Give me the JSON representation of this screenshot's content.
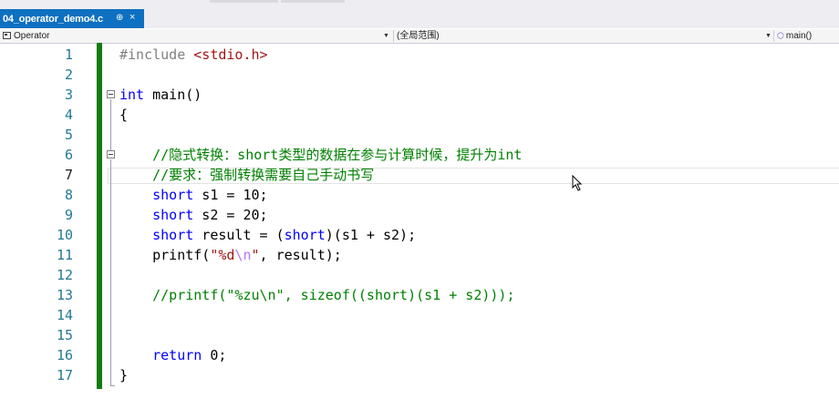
{
  "tab": {
    "title": "04_operator_demo4.c",
    "pin_glyph": "⊕",
    "close_glyph": "×"
  },
  "navbar": {
    "project": "Operator",
    "scope": "(全局范围)",
    "member": "main()"
  },
  "colors": {
    "tab_active": "#0e70c0",
    "change_bar": "#107c10",
    "keyword": "#0000ff",
    "comment": "#008000",
    "string": "#a31515",
    "line_number": "#237893"
  },
  "icons": [
    "project-icon",
    "dropdown-arrow-icon",
    "function-member-icon",
    "pin-icon",
    "close-icon",
    "collapse-icon",
    "mouse-pointer-icon"
  ],
  "editor": {
    "current_line": 7,
    "lines": [
      {
        "n": "1",
        "tokens": [
          [
            "pp",
            "#include "
          ],
          [
            "str",
            "<stdio.h>"
          ]
        ]
      },
      {
        "n": "2",
        "tokens": []
      },
      {
        "n": "3",
        "tokens": [
          [
            "kw",
            "int"
          ],
          [
            "",
            " main()"
          ]
        ]
      },
      {
        "n": "4",
        "tokens": [
          [
            "",
            "{"
          ]
        ]
      },
      {
        "n": "5",
        "tokens": []
      },
      {
        "n": "6",
        "tokens": [
          [
            "",
            "    "
          ],
          [
            "cm",
            "//隐式转换：short类型的数据在参与计算时候，提升为int"
          ]
        ]
      },
      {
        "n": "7",
        "tokens": [
          [
            "",
            "    "
          ],
          [
            "cm",
            "//要求：强制转换需要自己手动书写"
          ]
        ]
      },
      {
        "n": "8",
        "tokens": [
          [
            "",
            "    "
          ],
          [
            "kw",
            "short"
          ],
          [
            "",
            " s1 = 10;"
          ]
        ]
      },
      {
        "n": "9",
        "tokens": [
          [
            "",
            "    "
          ],
          [
            "kw",
            "short"
          ],
          [
            "",
            " s2 = 20;"
          ]
        ]
      },
      {
        "n": "10",
        "tokens": [
          [
            "",
            "    "
          ],
          [
            "kw",
            "short"
          ],
          [
            "",
            " result = ("
          ],
          [
            "kw",
            "short"
          ],
          [
            "",
            ")(s1 + s2);"
          ]
        ]
      },
      {
        "n": "11",
        "tokens": [
          [
            "",
            "    printf("
          ],
          [
            "str",
            "\"%d"
          ],
          [
            "esc",
            "\\n"
          ],
          [
            "str",
            "\""
          ],
          [
            "",
            ", result);"
          ]
        ]
      },
      {
        "n": "12",
        "tokens": []
      },
      {
        "n": "13",
        "tokens": [
          [
            "",
            "    "
          ],
          [
            "cm",
            "//printf(\"%zu\\n\", sizeof((short)(s1 + s2)));"
          ]
        ]
      },
      {
        "n": "14",
        "tokens": []
      },
      {
        "n": "15",
        "tokens": []
      },
      {
        "n": "16",
        "tokens": [
          [
            "",
            "    "
          ],
          [
            "kw",
            "return"
          ],
          [
            "",
            " 0;"
          ]
        ]
      },
      {
        "n": "17",
        "tokens": [
          [
            "",
            "}"
          ]
        ]
      }
    ]
  }
}
